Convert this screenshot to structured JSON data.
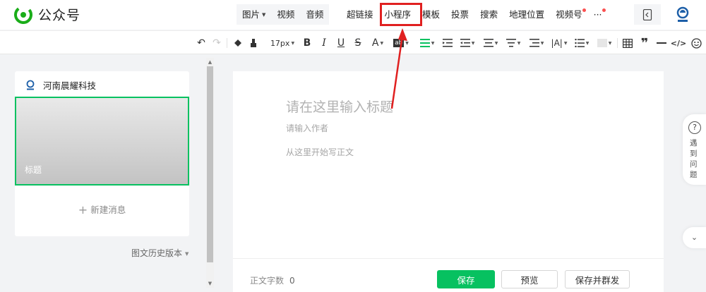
{
  "brand": {
    "name": "公众号",
    "accent": "#07c160"
  },
  "insert_toolbar": {
    "media": [
      {
        "label": "图片",
        "has_caret": true
      },
      {
        "label": "视频"
      },
      {
        "label": "音频"
      }
    ],
    "tools": [
      {
        "label": "超链接"
      },
      {
        "label": "小程序",
        "highlighted": true
      },
      {
        "label": "模板"
      },
      {
        "label": "投票"
      },
      {
        "label": "搜索"
      },
      {
        "label": "地理位置"
      },
      {
        "label": "视频号",
        "red_dot": true
      },
      {
        "label": "···",
        "red_dot": true
      }
    ],
    "annotation_color": "#e02020"
  },
  "format_toolbar": {
    "font_size": "17px",
    "icons": [
      "undo-icon",
      "redo-icon",
      "format-painter-icon",
      "clear-format-icon",
      "bold-icon",
      "italic-icon",
      "underline-icon",
      "strikethrough-icon",
      "font-color-icon",
      "background-color-icon",
      "align-icon",
      "indent-icon",
      "outdent-icon",
      "line-height-icon",
      "paragraph-spacing-icon",
      "list-spacing-icon",
      "letter-spacing-icon",
      "unordered-list-icon",
      "ordered-list-icon",
      "table-icon",
      "quote-icon",
      "divider-icon",
      "code-icon",
      "emoji-icon"
    ],
    "labels": {
      "bold": "B",
      "italic": "I",
      "underline": "U",
      "strike": "S",
      "font_color": "A",
      "bg_color": "ab",
      "quote": "❞",
      "code": "</>"
    }
  },
  "left_panel": {
    "account_name": "河南晨耀科技",
    "cover_title": "标题",
    "new_message": "新建消息",
    "history": "图文历史版本"
  },
  "editor": {
    "title_placeholder": "请在这里输入标题",
    "author_placeholder": "请输入作者",
    "body_placeholder": "从这里开始写正文"
  },
  "bottom_bar": {
    "word_count_label": "正文字数",
    "word_count": "0",
    "save": "保存",
    "preview": "预览",
    "save_publish": "保存并群发"
  },
  "help": {
    "label": "遇到问题",
    "icon_text": "?",
    "fold": "⌄"
  }
}
